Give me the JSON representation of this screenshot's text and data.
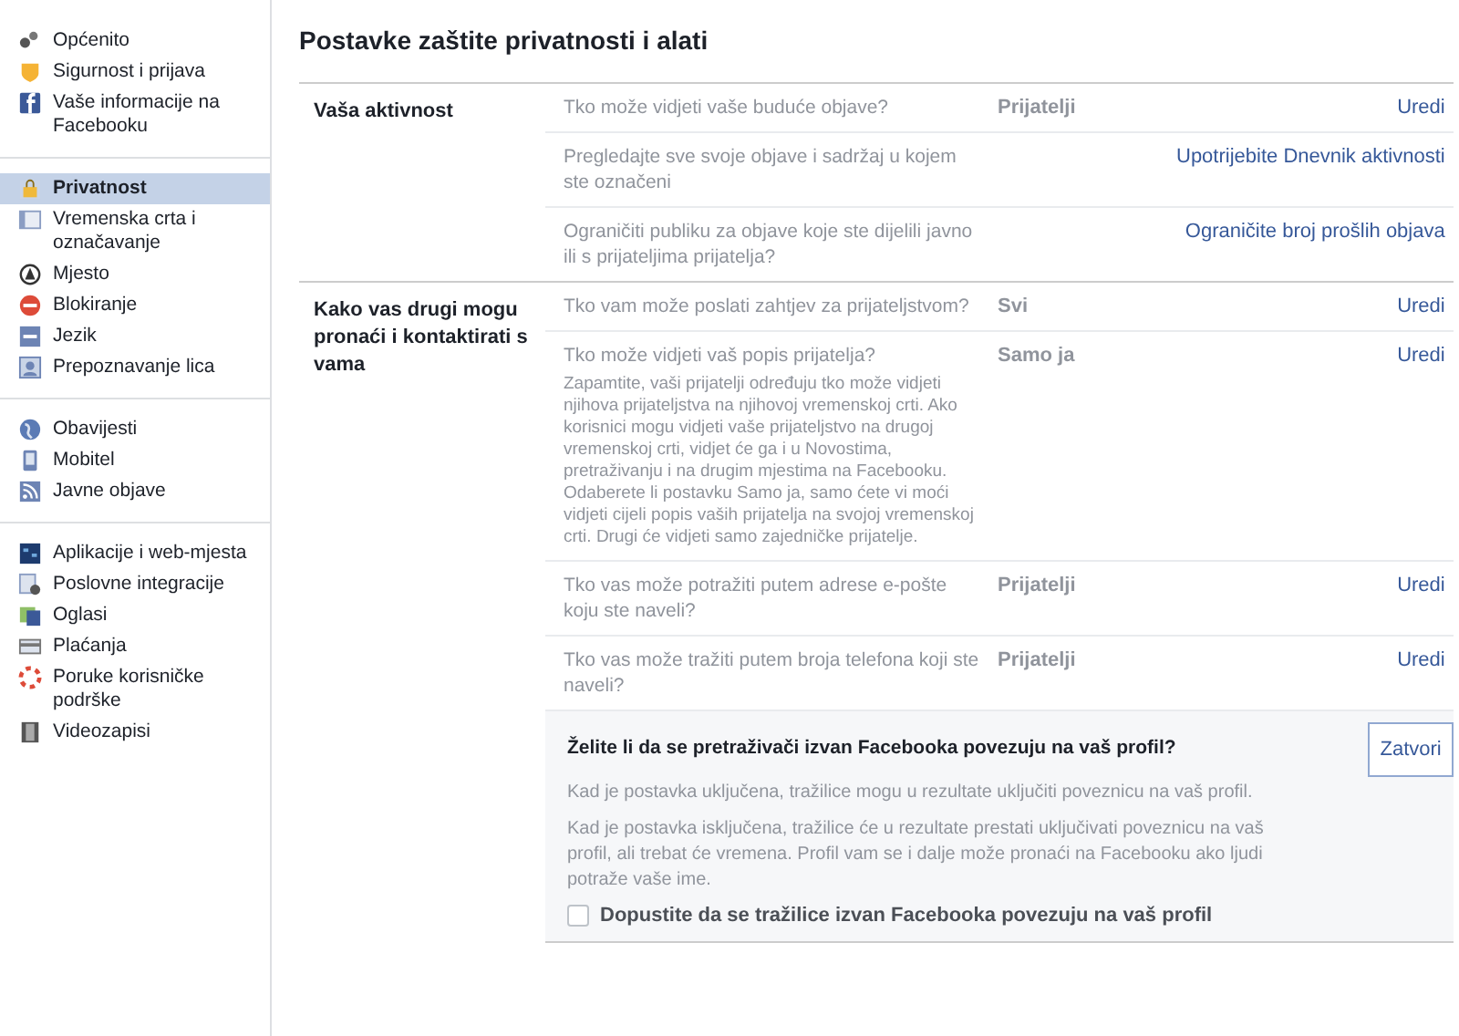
{
  "sidebar": {
    "groups": [
      {
        "items": [
          {
            "label": "Općenito",
            "selected": false
          },
          {
            "label": "Sigurnost i prijava",
            "selected": false
          },
          {
            "label": "Vaše informacije na Facebooku",
            "selected": false
          }
        ]
      },
      {
        "items": [
          {
            "label": "Privatnost",
            "selected": true
          },
          {
            "label": "Vremenska crta i označavanje",
            "selected": false
          },
          {
            "label": "Mjesto",
            "selected": false
          },
          {
            "label": "Blokiranje",
            "selected": false
          },
          {
            "label": "Jezik",
            "selected": false
          },
          {
            "label": "Prepoznavanje lica",
            "selected": false
          }
        ]
      },
      {
        "items": [
          {
            "label": "Obavijesti",
            "selected": false
          },
          {
            "label": "Mobitel",
            "selected": false
          },
          {
            "label": "Javne objave",
            "selected": false
          }
        ]
      },
      {
        "items": [
          {
            "label": "Aplikacije i web-mjesta",
            "selected": false
          },
          {
            "label": "Poslovne integracije",
            "selected": false
          },
          {
            "label": "Oglasi",
            "selected": false
          },
          {
            "label": "Plaćanja",
            "selected": false
          },
          {
            "label": "Poruke korisničke podrške",
            "selected": false
          },
          {
            "label": "Videozapisi",
            "selected": false
          }
        ]
      }
    ]
  },
  "title": "Postavke zaštite privatnosti i alati",
  "sections": [
    {
      "heading": "Vaša aktivnost",
      "rows": [
        {
          "question": "Tko može vidjeti vaše buduće objave?",
          "value": "Prijatelji",
          "action": "Uredi"
        },
        {
          "question": "Pregledajte sve svoje objave i sadržaj u kojem ste označeni",
          "action": "Upotrijebite Dnevnik aktivnosti"
        },
        {
          "question": "Ograničiti publiku za objave koje ste dijelili javno ili s prijateljima prijatelja?",
          "action": "Ograničite broj prošlih objava"
        }
      ]
    },
    {
      "heading": "Kako vas drugi mogu pronaći i kontaktirati s vama",
      "rows": [
        {
          "question": "Tko vam može poslati zahtjev za prijateljstvom?",
          "value": "Svi",
          "action": "Uredi"
        },
        {
          "question": "Tko može vidjeti vaš popis prijatelja?",
          "description": "Zapamtite, vaši prijatelji određuju tko može vidjeti njihova prijateljstva na njihovoj vremenskoj crti. Ako korisnici mogu vidjeti vaše prijateljstvo na drugoj vremenskoj crti, vidjet će ga i u Novostima, pretraživanju i na drugim mjestima na Facebooku. Odaberete li postavku Samo ja, samo ćete vi moći vidjeti cijeli popis vaših prijatelja na svojoj vremenskoj crti. Drugi će vidjeti samo zajedničke prijatelje.",
          "value": "Samo ja",
          "action": "Uredi"
        },
        {
          "question": "Tko vas može potražiti putem adrese e-pošte koju ste naveli?",
          "value": "Prijatelji",
          "action": "Uredi"
        },
        {
          "question": "Tko vas može tražiti putem broja telefona koji ste naveli?",
          "value": "Prijatelji",
          "action": "Uredi"
        }
      ],
      "panel": {
        "question": "Želite li da se pretraživači izvan Facebooka povezuju na vaš profil?",
        "close_button": "Zatvori",
        "paragraphs": [
          "Kad je postavka uključena, tražilice mogu u rezultate uključiti poveznicu na vaš profil.",
          "Kad je postavka isključena, tražilice će u rezultate prestati uključivati poveznicu na vaš profil, ali trebat će vremena. Profil vam se i dalje može pronaći na Facebooku ako ljudi potraže vaše ime."
        ],
        "checkbox": {
          "label": "Dopustite da se tražilice izvan Facebooka povezuju na vaš profil",
          "checked": false
        }
      }
    }
  ]
}
